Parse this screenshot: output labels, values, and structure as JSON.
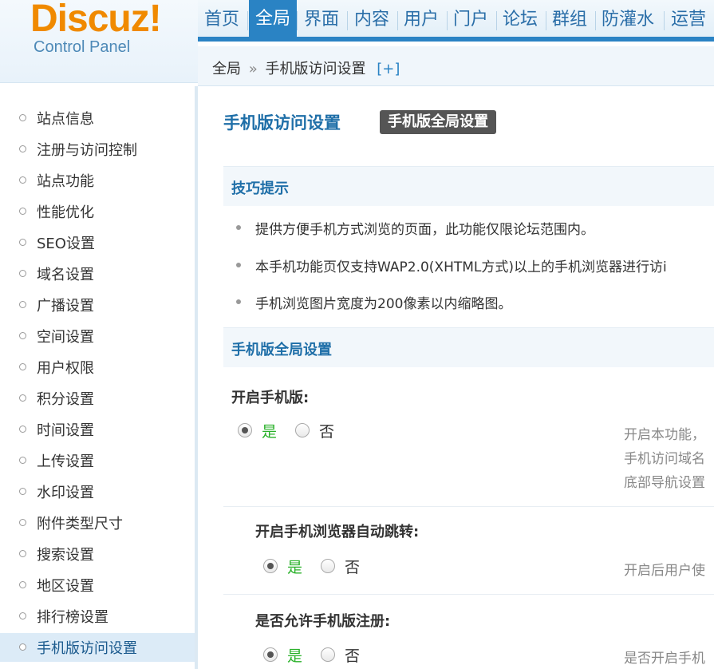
{
  "logo": {
    "brand": "Discuz!",
    "subtitle": "Control Panel"
  },
  "topnav": {
    "items": [
      "首页",
      "全局",
      "界面",
      "内容",
      "用户",
      "门户",
      "论坛",
      "群组",
      "防灌水",
      "运营"
    ],
    "active_index": 1
  },
  "breadcrumb": {
    "root": "全局",
    "separator": "»",
    "current": "手机版访问设置",
    "add": "[+]"
  },
  "sidebar": {
    "items": [
      "站点信息",
      "注册与访问控制",
      "站点功能",
      "性能优化",
      "SEO设置",
      "域名设置",
      "广播设置",
      "空间设置",
      "用户权限",
      "积分设置",
      "时间设置",
      "上传设置",
      "水印设置",
      "附件类型尺寸",
      "搜索设置",
      "地区设置",
      "排行榜设置",
      "手机版访问设置"
    ],
    "active_index": 17
  },
  "main": {
    "title": "手机版访问设置",
    "tab": "手机版全局设置",
    "tips": {
      "heading": "技巧提示",
      "items": [
        "提供方便手机方式浏览的页面，此功能仅限论坛范围内。",
        "本手机功能页仅支持WAP2.0(XHTML方式)以上的手机浏览器进行访i",
        "手机浏览图片宽度为200像素以内缩略图。"
      ]
    },
    "settings": {
      "heading": "手机版全局设置",
      "fields": [
        {
          "label": "开启手机版:",
          "yes": "是",
          "no": "否",
          "checked": "yes",
          "desc": [
            "开启本功能，",
            "手机访问域名",
            "底部导航设置"
          ]
        },
        {
          "label": "开启手机浏览器自动跳转:",
          "yes": "是",
          "no": "否",
          "checked": "yes",
          "desc": [
            "开启后用户使"
          ]
        },
        {
          "label": "是否允许手机版注册:",
          "yes": "是",
          "no": "否",
          "checked": "yes",
          "desc": [
            "是否开启手机"
          ]
        }
      ]
    }
  },
  "colors": {
    "accent": "#2a83c4",
    "logo": "#f08a00",
    "yes": "#2ab12a",
    "title": "#1f6fa8"
  }
}
